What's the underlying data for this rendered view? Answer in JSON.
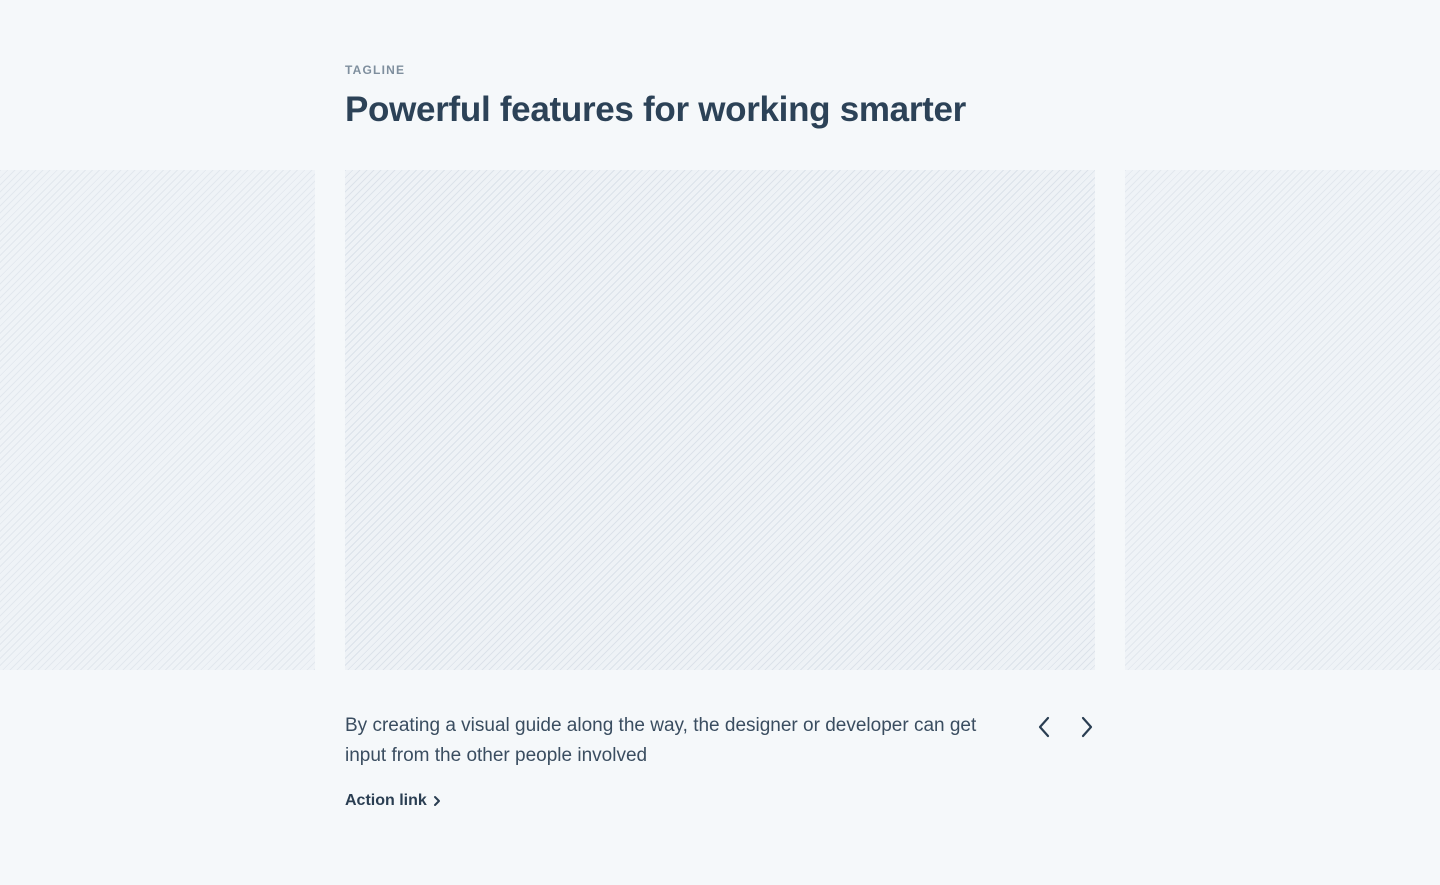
{
  "header": {
    "tagline": "TAGLINE",
    "title": "Powerful features for working smarter"
  },
  "carousel": {
    "caption": "By creating a visual guide along the way, the designer or developer can get input from the other people involved",
    "action_link": "Action link",
    "prev_icon": "chevron-left-icon",
    "next_icon": "chevron-right-icon"
  },
  "colors": {
    "background": "#f5f8fa",
    "text": "#2a3e52",
    "muted": "#7f8f9e",
    "placeholder": "#eef2f6"
  }
}
